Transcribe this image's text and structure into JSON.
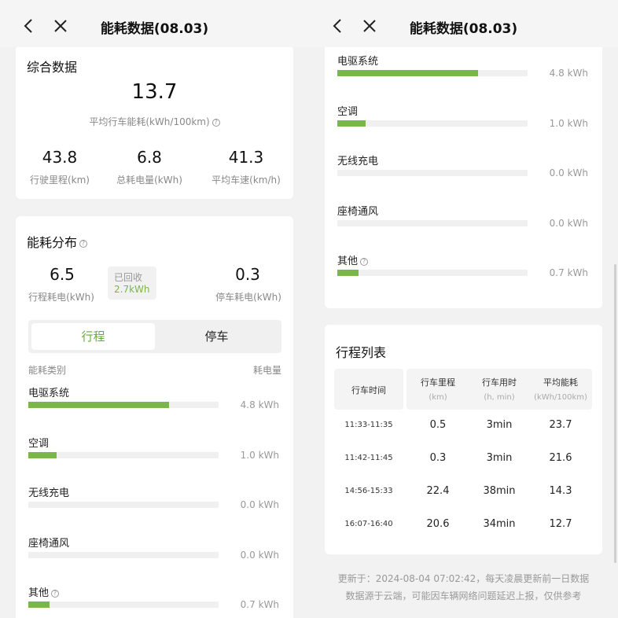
{
  "nav": {
    "title": "能耗数据(08.03)",
    "back_icon": "chevron-left-icon",
    "close_icon": "close-icon"
  },
  "summary": {
    "title": "综合数据",
    "avg_value": "13.7",
    "avg_label": "平均行车能耗(kWh/100km)",
    "stats": [
      {
        "value": "43.8",
        "label": "行驶里程(km)"
      },
      {
        "value": "6.8",
        "label": "总耗电量(kWh)"
      },
      {
        "value": "41.3",
        "label": "平均车速(km/h)"
      }
    ]
  },
  "distribution": {
    "title": "能耗分布",
    "driving": {
      "value": "6.5",
      "label": "行程耗电(kWh)"
    },
    "recovered": {
      "label": "已回收",
      "value": "2.7kWh"
    },
    "parking": {
      "value": "0.3",
      "label": "停车耗电(kWh)"
    },
    "tabs": [
      {
        "label": "行程",
        "active": true
      },
      {
        "label": "停车",
        "active": false
      }
    ],
    "col_category": "能耗类别",
    "col_consumption": "耗电量",
    "items": [
      {
        "name": "电驱系统",
        "value": "4.8 kWh",
        "ratio": 0.74,
        "has_help": false
      },
      {
        "name": "空调",
        "value": "1.0 kWh",
        "ratio": 0.15,
        "has_help": false
      },
      {
        "name": "无线充电",
        "value": "0.0 kWh",
        "ratio": 0.0,
        "has_help": false
      },
      {
        "name": "座椅通风",
        "value": "0.0 kWh",
        "ratio": 0.0,
        "has_help": false
      },
      {
        "name": "其他",
        "value": "0.7 kWh",
        "ratio": 0.11,
        "has_help": true
      }
    ]
  },
  "trips": {
    "title": "行程列表",
    "headers": [
      {
        "main": "行车时间",
        "sub": ""
      },
      {
        "main": "行车里程",
        "sub": "(km)"
      },
      {
        "main": "行车用时",
        "sub": "(h, min)"
      },
      {
        "main": "平均能耗",
        "sub": "(kWh/100km)"
      }
    ],
    "rows": [
      [
        "11:33-11:35",
        "0.5",
        "3min",
        "23.7"
      ],
      [
        "11:42-11:45",
        "0.3",
        "3min",
        "21.6"
      ],
      [
        "14:56-15:33",
        "22.4",
        "38min",
        "14.3"
      ],
      [
        "16:07-16:40",
        "20.6",
        "34min",
        "12.7"
      ]
    ]
  },
  "footer": {
    "line1": "更新于：2024-08-04 07:02:42，每天凌晨更新前一日数据",
    "line2": "数据源于云端，可能因车辆网络问题延迟上报，仅供参考"
  },
  "colors": {
    "accent": "#7ab648",
    "tab_active_text": "#6aaa3a"
  }
}
